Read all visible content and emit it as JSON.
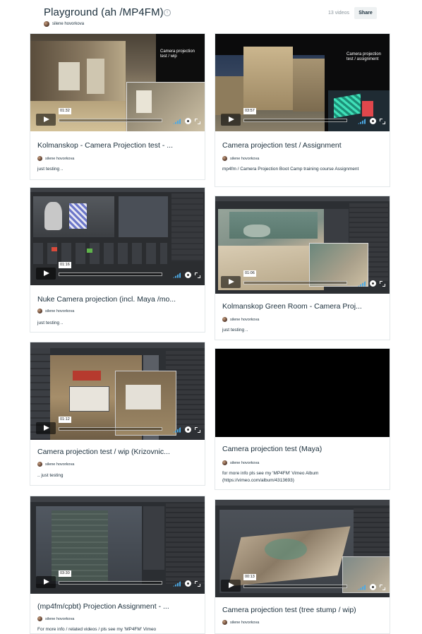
{
  "album": {
    "title": "Playground (ah /MP4FM)",
    "owner": "silene hovorkova",
    "video_count": "13 videos",
    "share_label": "Share"
  },
  "videos": [
    {
      "title": "Kolmanskop - Camera Projection test - ...",
      "duration": "01:32",
      "owner": "silene hovorkova",
      "description": "just testing ..",
      "overlay": "Camera projection test / wip"
    },
    {
      "title": "Camera projection test / Assignment",
      "duration": "03:57",
      "owner": "silene hovorkova",
      "description": "mp4fm / Camera Projection Boot Camp training course Assignment",
      "overlay": "Camera projection test / assignment"
    },
    {
      "title": "Nuke Camera projection (incl. Maya /mo...",
      "duration": "01:16",
      "owner": "silene hovorkova",
      "description": "just testing .."
    },
    {
      "title": "Kolmanskop Green Room - Camera Proj...",
      "duration": "01:06",
      "owner": "silene hovorkova",
      "description": "just testing .."
    },
    {
      "title": "Camera projection test / wip (Krizovnic...",
      "duration": "01:12",
      "owner": "silene hovorkova",
      "description": ".. just testing"
    },
    {
      "title": "Camera projection test (Maya)",
      "duration": "",
      "owner": "silene hovorkova",
      "description": "for more info pls see my 'MP4FM' Vimeo Album (https://vimeo.com/album/4313693)"
    },
    {
      "title": "(mp4fm/cpbt) Projection Assignment - ...",
      "duration": "03:30",
      "owner": "silene hovorkova",
      "description": "For more info / related videos / pls see my 'MP4FM' Vimeo"
    },
    {
      "title": "Camera projection test (tree stump / wip)",
      "duration": "00:13",
      "owner": "silene hovorkova",
      "description": ""
    }
  ],
  "colors": {
    "accent": "#4ca9e4",
    "text": "#1a2e3b",
    "muted": "#8a959c"
  }
}
